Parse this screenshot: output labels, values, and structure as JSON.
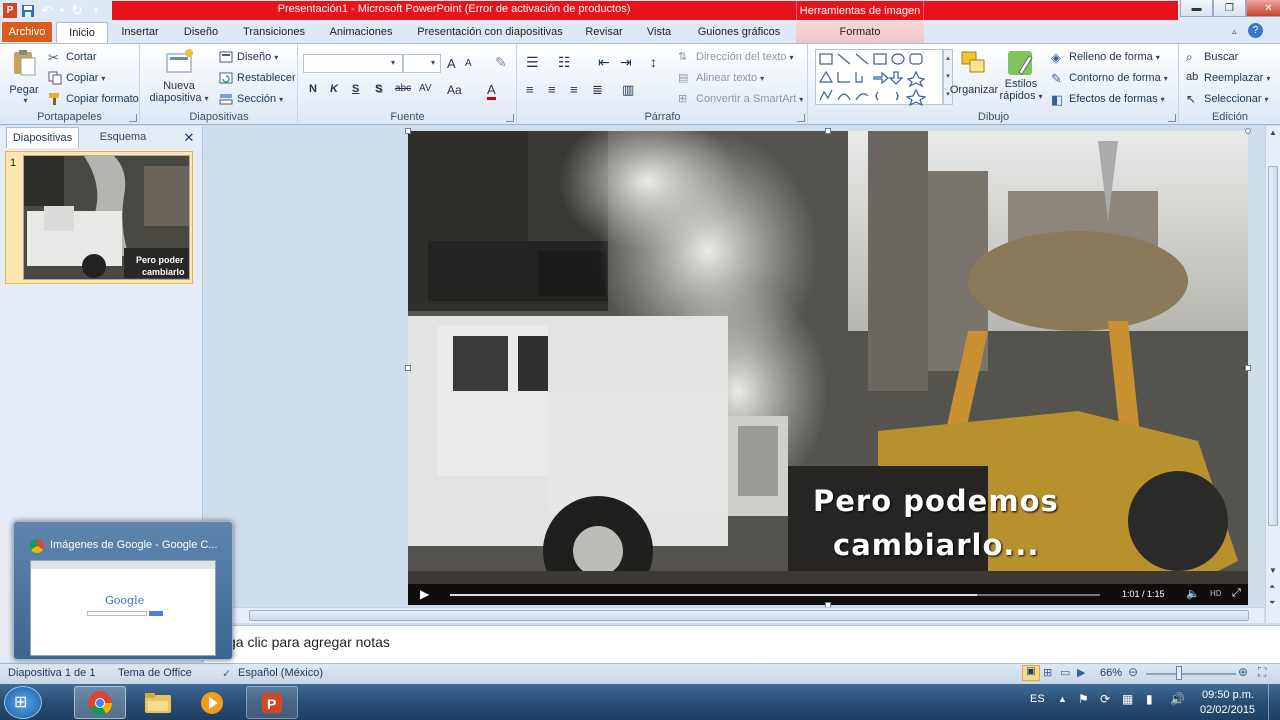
{
  "window": {
    "title": "Presentación1  -  Microsoft PowerPoint (Error de activación de productos)",
    "context_tab_header": "Herramientas de imagen",
    "min_label": "▬",
    "max_label": "❐",
    "close_label": "✕"
  },
  "tabs": {
    "file": "Archivo",
    "items": [
      "Inicio",
      "Insertar",
      "Diseño",
      "Transiciones",
      "Animaciones",
      "Presentación con diapositivas",
      "Revisar",
      "Vista",
      "Guiones gráficos"
    ],
    "context": "Formato"
  },
  "ribbon": {
    "portapapeles": {
      "label": "Portapapeles",
      "paste": "Pegar",
      "cut": "Cortar",
      "copy": "Copiar",
      "format_painter": "Copiar formato"
    },
    "diapositivas": {
      "label": "Diapositivas",
      "new_slide_1": "Nueva",
      "new_slide_2": "diapositiva",
      "layout": "Diseño",
      "reset": "Restablecer",
      "section": "Sección"
    },
    "fuente": {
      "label": "Fuente",
      "font_name": "",
      "font_size": "",
      "bold": "N",
      "italic": "K",
      "underline": "S",
      "shadow": "S",
      "strike": "abc",
      "spacing": "AV",
      "case": "Aa",
      "color": "A",
      "grow": "A",
      "shrink": "A"
    },
    "parrafo": {
      "label": "Párrafo",
      "text_direction": "Dirección del texto",
      "align_text": "Alinear texto",
      "smartart": "Convertir a SmartArt"
    },
    "dibujo": {
      "label": "Dibujo",
      "arrange": "Organizar",
      "quick_styles_1": "Estilos",
      "quick_styles_2": "rápidos",
      "shape_fill": "Relleno de forma",
      "shape_outline": "Contorno de forma",
      "shape_effects": "Efectos de formas"
    },
    "edicion": {
      "label": "Edición",
      "find": "Buscar",
      "replace": "Reemplazar",
      "select": "Seleccionar"
    }
  },
  "left_pane": {
    "tab_slides": "Diapositivas",
    "tab_outline": "Esquema",
    "close": "✕",
    "slide_number": "1",
    "thumb_caption_1": "Pero poder",
    "thumb_caption_2": "cambiarlo"
  },
  "slide": {
    "caption_1": "Pero podemos",
    "caption_2": "cambiarlo...",
    "video_time": "1:01 / 1:15",
    "hd_label": "HD",
    "progress": 0.81
  },
  "notes": {
    "placeholder": "ga clic para agregar notas"
  },
  "status": {
    "slide_info": "Diapositiva 1 de 1",
    "theme": "Tema de Office",
    "language": "Español (México)",
    "zoom": "66%",
    "zoom_level": 0.66
  },
  "taskbar": {
    "lang": "ES",
    "time": "09:50 p.m.",
    "date": "02/02/2015",
    "preview_title": "Imágenes de Google - Google C...",
    "preview_logo": "Google"
  },
  "colors": {
    "title_red": "#e8131a",
    "file_tab": "#d85d1c",
    "ribbon_bg": "#e6eef8",
    "taskbar": "#2a4e74"
  }
}
